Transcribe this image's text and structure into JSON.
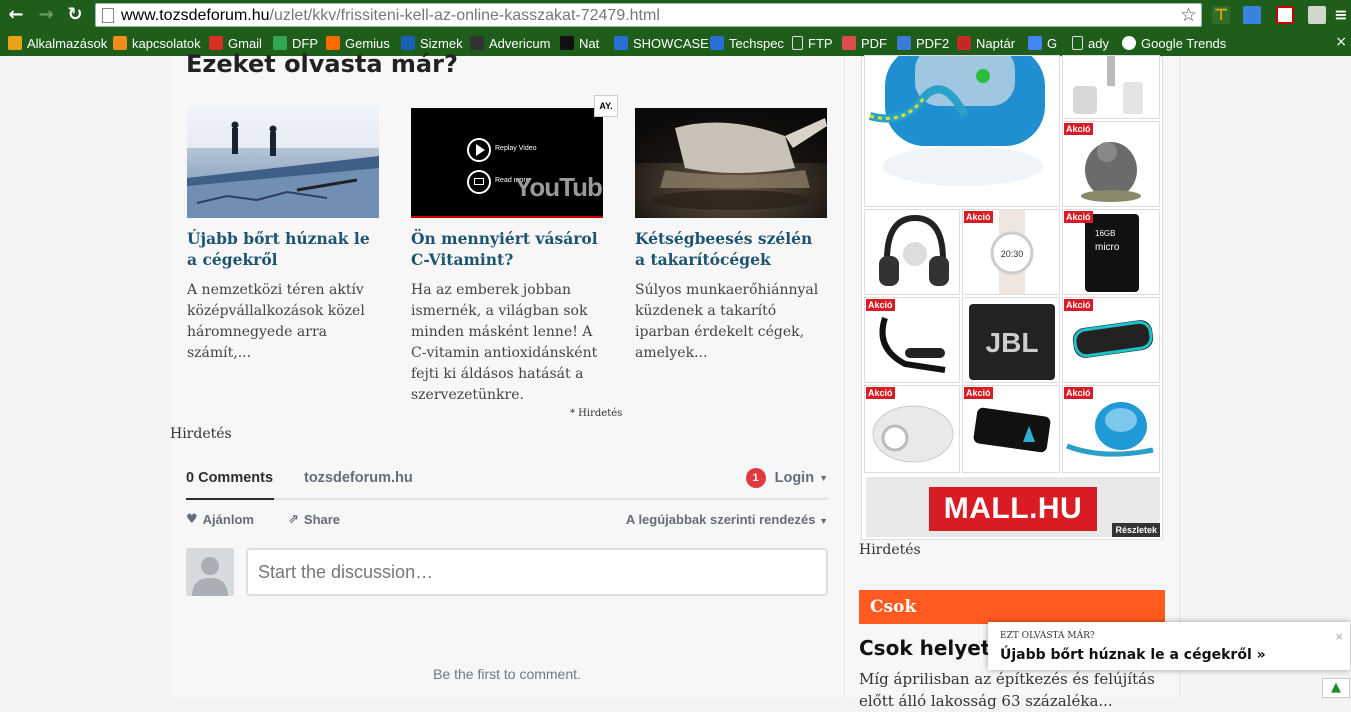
{
  "browser": {
    "url_host": "www.tozsdeforum.hu",
    "url_path": "/uzlet/kkv/frissiteni-kell-az-online-kasszakat-72479.html",
    "bookmarks": [
      {
        "label": "Alkalmazások",
        "color": "#e8a317"
      },
      {
        "label": "kapcsolatok",
        "color": "#f28c1b"
      },
      {
        "label": "Gmail",
        "color": "#d93025"
      },
      {
        "label": "DFP",
        "color": "#32a852"
      },
      {
        "label": "Gemius",
        "color": "#ff6a00"
      },
      {
        "label": "Sizmek",
        "color": "#1a5fb4"
      },
      {
        "label": "Advericum",
        "color": "#333333"
      },
      {
        "label": "Nat",
        "color": "#111111"
      },
      {
        "label": "SHOWCASE",
        "color": "#2a6fd6"
      },
      {
        "label": "Techspec",
        "color": "#2a6fd6"
      },
      {
        "label": "FTP",
        "color": "doc"
      },
      {
        "label": "PDF",
        "color": "#e04b4b"
      },
      {
        "label": "PDF2",
        "color": "#3a7bd5"
      },
      {
        "label": "Naptár",
        "color": "#c62828"
      },
      {
        "label": "G",
        "color": "#4285f4"
      },
      {
        "label": "ady",
        "color": "doc"
      },
      {
        "label": "Google Trends",
        "color": "#ffffff"
      }
    ]
  },
  "section": {
    "title": "Ezeket olvasta már?"
  },
  "cards": [
    {
      "title": "Újabb bőrt húznak le a cégekről",
      "text": "A nemzetközi téren aktív középvállalkozások közel háromnegyede arra számít,..."
    },
    {
      "title": "Ön mennyiért vásárol C-Vitamint?",
      "text": "Ha az emberek jobban ismernék, a világban sok minden másként lenne! A C-vitamin antioxidánsként fejti ki áldásos hatását a szervezetünkre.",
      "video_replay": "Replay Video",
      "video_read": "Read more",
      "video_brand": "YouTube",
      "ad_label": "AY."
    },
    {
      "title": "Kétségbeesés szélén a takarítócégek",
      "text": "Súlyos munkaerőhiánnyal küzdenek a takarító iparban érdekelt cégek, amelyek..."
    }
  ],
  "sponsored_note": "* Hirdetés",
  "hirdetes_label": "Hirdetés",
  "disqus": {
    "comments_tab": "0 Comments",
    "site_tab": "tozsdeforum.hu",
    "login_badge": "1",
    "login": "Login",
    "recommend": "Ajánlom",
    "share": "Share",
    "sort": "A legújabbak szerinti rendezés",
    "input_placeholder": "Start the discussion…",
    "empty": "Be the first to comment."
  },
  "sidebar": {
    "akcio": "Akció",
    "mall_logo": "MALL.HU",
    "reszletek": "Részletek",
    "hirdetes": "Hirdetés",
    "category": "Csok",
    "article_title": "Csok helyett",
    "article_text": "Míg áprilisban az építkezés és felújítás előtt álló lakosság 63 százaléka..."
  },
  "popup": {
    "kicker": "EZT OLVASTA MÁR?",
    "link": "Újabb bőrt húznak le a cégekről »",
    "close": "×"
  },
  "colors": {
    "toolbar": "#1f5d1a",
    "link": "#1d5570",
    "accent": "#ff5a1f",
    "mall_red": "#d91c24"
  }
}
